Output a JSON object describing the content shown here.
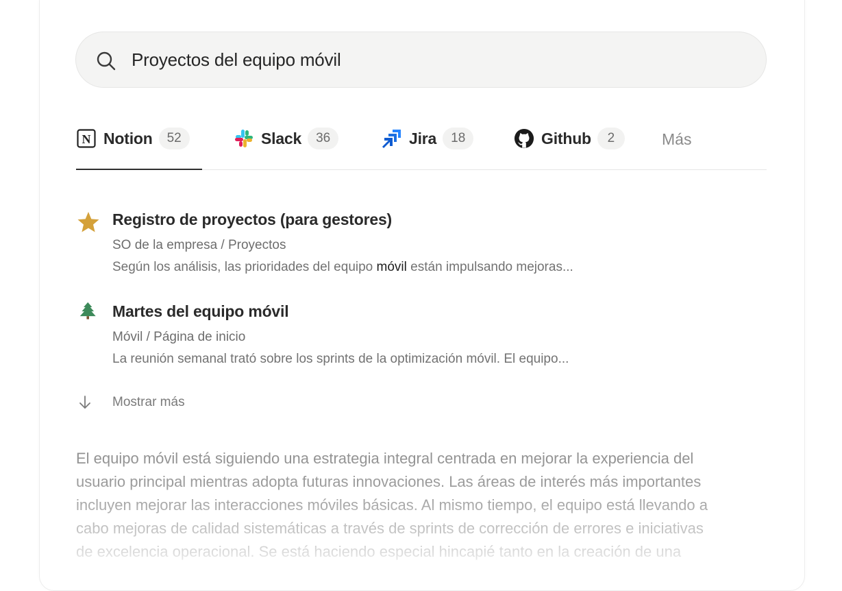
{
  "search": {
    "value": "Proyectos del equipo móvil",
    "icon": "search-icon"
  },
  "tabs": [
    {
      "label": "Notion",
      "count": "52",
      "icon": "notion-logo-icon",
      "active": true
    },
    {
      "label": "Slack",
      "count": "36",
      "icon": "slack-logo-icon",
      "active": false
    },
    {
      "label": "Jira",
      "count": "18",
      "icon": "jira-logo-icon",
      "active": false
    },
    {
      "label": "Github",
      "count": "2",
      "icon": "github-logo-icon",
      "active": false
    }
  ],
  "more_tab": "Más",
  "results": [
    {
      "icon": "star-icon",
      "title": "Registro de proyectos (para gestores)",
      "path": "SO de la empresa / Proyectos",
      "snippet_before": "Según los análisis, las prioridades del equipo ",
      "snippet_highlight": "móvil",
      "snippet_after": " están impulsando mejoras..."
    },
    {
      "icon": "tree-icon",
      "title": "Martes del equipo móvil",
      "path": "Móvil / Página de inicio",
      "snippet": "La reunión semanal trató sobre los sprints de la optimización móvil. El equipo..."
    }
  ],
  "show_more": "Mostrar más",
  "answer_lines": [
    "El equipo móvil está siguiendo una estrategia integral centrada en mejorar la experiencia del",
    "usuario principal mientras adopta futuras innovaciones. Las áreas de interés más importantes",
    "incluyen mejorar las interacciones móviles básicas. Al mismo tiempo, el equipo está llevando a",
    "cabo mejoras de calidad sistemáticas a través de sprints de corrección de errores e iniciativas",
    "de excelencia operacional. Se está haciendo especial hincapié tanto en la creación de una"
  ],
  "colors": {
    "star": "#d4a13a",
    "tree": "#3d8a5a",
    "jira": "#2684ff",
    "active_tab_underline": "#2f2f2f"
  }
}
